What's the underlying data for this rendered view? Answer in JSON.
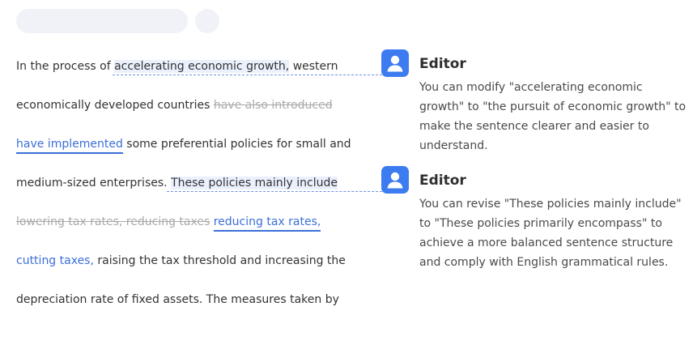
{
  "document": {
    "line1": {
      "pre": "In the process of ",
      "highlight": "accelerating economic growth,",
      "post": " western"
    },
    "line2": {
      "pre": "economically developed countries ",
      "deleted": "have also introduced"
    },
    "line3": {
      "inserted": "have implemented",
      "post": " some preferential policies for small and"
    },
    "line4": {
      "pre": "medium-sized enterprises. ",
      "highlight": "These policies mainly include"
    },
    "line5": {
      "deleted": "lowering tax rates, reducing taxes",
      "gap": " ",
      "inserted": "reducing tax rates,"
    },
    "line6": {
      "inserted": "cutting taxes,",
      "post": " raising the tax threshold and increasing the"
    },
    "line7": {
      "text": "depreciation rate of fixed assets. The measures taken by"
    }
  },
  "comments": [
    {
      "author": "Editor",
      "icon": "user-avatar-icon",
      "text": "You can modify \"accelerating economic growth\" to \"the pursuit of economic growth\" to make the sentence clearer and easier to understand."
    },
    {
      "author": "Editor",
      "icon": "user-avatar-icon",
      "text": "You can revise \"These policies mainly include\" to \"These policies primarily encompass\" to achieve a more balanced sentence structure and comply with English grammatical rules."
    }
  ],
  "colors": {
    "accent": "#3d7bf0",
    "inserted_text": "#3b6fd8",
    "deleted_text": "#a9a9a9",
    "highlight_bg": "#eaf0fc"
  }
}
